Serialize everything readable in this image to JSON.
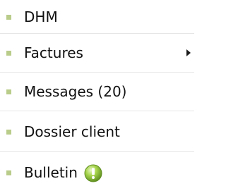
{
  "menu": {
    "items": [
      {
        "label": "DHM",
        "bullet_icon": "square-bullet-icon"
      },
      {
        "label": "Factures",
        "bullet_icon": "square-bullet-icon",
        "submenu_icon": "chevron-right-icon"
      },
      {
        "label": "Messages (20)",
        "bullet_icon": "square-bullet-icon"
      },
      {
        "label": "Dossier client",
        "bullet_icon": "square-bullet-icon"
      },
      {
        "label": "Bulletin",
        "bullet_icon": "square-bullet-icon",
        "status_icon": "alert-icon"
      }
    ]
  },
  "colors": {
    "bullet": "#b9cc8a",
    "text": "#111111",
    "divider": "#e6e6e6",
    "alert_icon": "#8fbf2f"
  }
}
